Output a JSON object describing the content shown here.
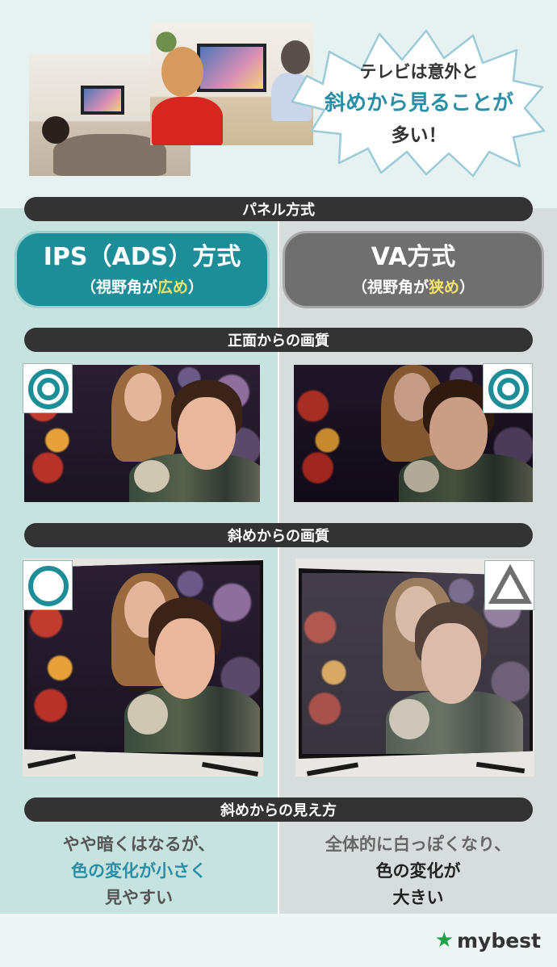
{
  "bubble": {
    "line1": "テレビは意外と",
    "line2": "斜めから見ることが",
    "line3": "多い！"
  },
  "sections": {
    "panel": "パネル方式",
    "front": "正面からの画質",
    "angle": "斜めからの画質",
    "view": "斜めからの見え方"
  },
  "panels": {
    "ips": {
      "title": "IPS（ADS）方式",
      "sub_pre": "（視野角が",
      "sub_hl": "広め",
      "sub_post": "）"
    },
    "va": {
      "title": "VA方式",
      "sub_pre": "（視野角が",
      "sub_hl": "狭め",
      "sub_post": "）"
    }
  },
  "ratings": {
    "ips_front": "double-circle-icon",
    "va_front": "double-circle-icon",
    "ips_angle": "circle-icon",
    "va_angle": "triangle-icon"
  },
  "descriptions": {
    "ips": {
      "line1": "やや暗くはなるが、",
      "line2": "色の変化が小さく",
      "line3": "見やすい"
    },
    "va": {
      "line1": "全体的に白っぽくなり、",
      "line2": "色の変化が",
      "line3": "大きい"
    }
  },
  "logo": {
    "text": "mybest"
  },
  "colors": {
    "teal": "#1d8d98",
    "gray": "#6f6f6f",
    "highlight": "#f4e36a",
    "brand_green": "#23a04a"
  }
}
